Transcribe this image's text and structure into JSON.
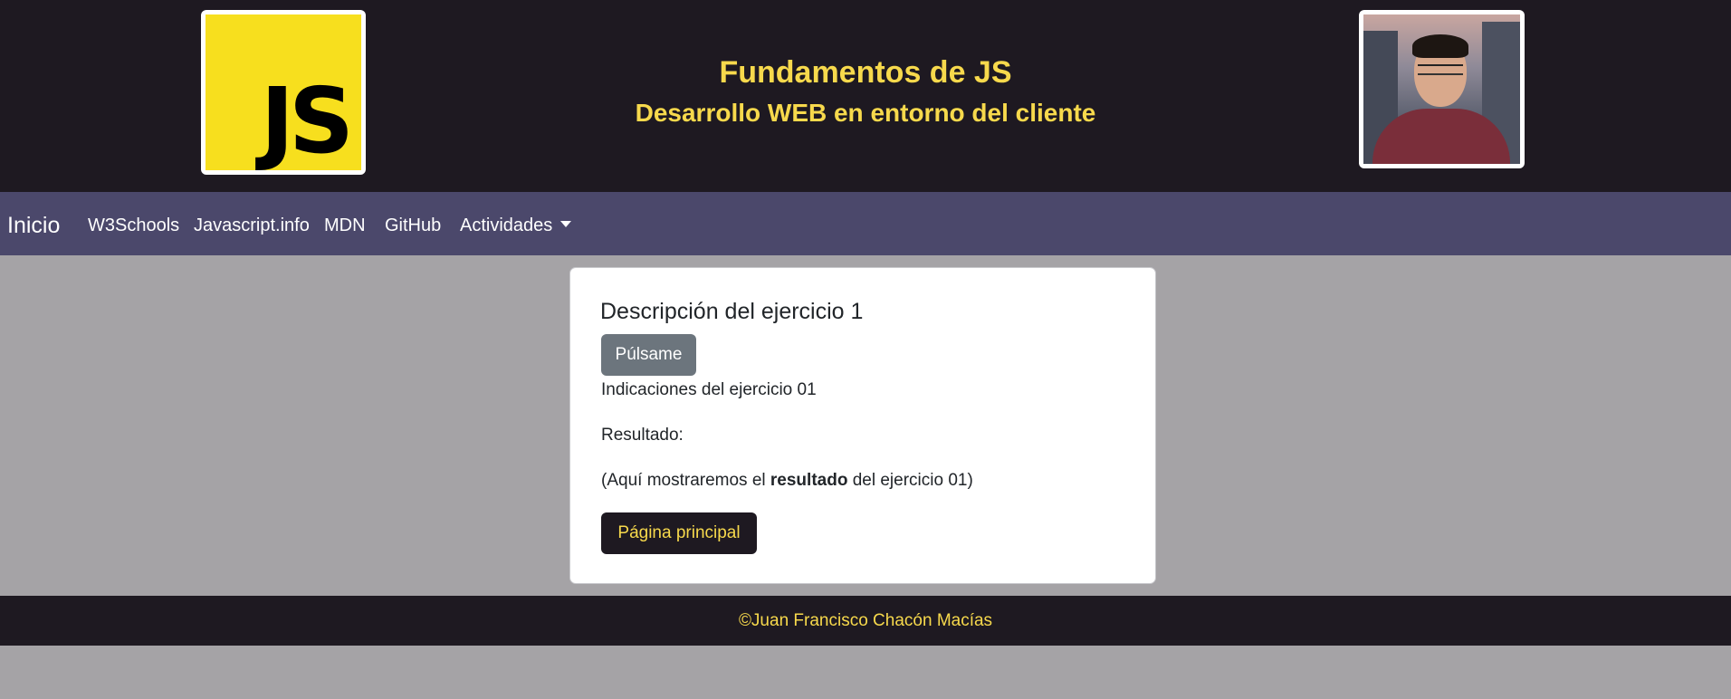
{
  "header": {
    "logo_text": "JS",
    "title": "Fundamentos de JS",
    "subtitle": "Desarrollo WEB en entorno del cliente",
    "brand_color": "#f7d94c",
    "logo_color": "#f7df1e",
    "background": "#1e1921"
  },
  "navbar": {
    "brand": "Inicio",
    "links": [
      "W3Schools",
      "Javascript.info",
      "MDN",
      "GitHub"
    ],
    "dropdown_label": "Actividades",
    "background": "#4b486b"
  },
  "card": {
    "title": "Descripción del ejercicio 1",
    "press_button": "Púlsame",
    "instructions": "Indicaciones del ejercicio 01",
    "result_label": "Resultado:",
    "result_prefix": "(Aquí mostraremos el ",
    "result_bold": "resultado",
    "result_suffix": " del ejercicio 01)",
    "main_page_button": "Página principal"
  },
  "footer": {
    "text": "©Juan Francisco Chacón Macías"
  }
}
